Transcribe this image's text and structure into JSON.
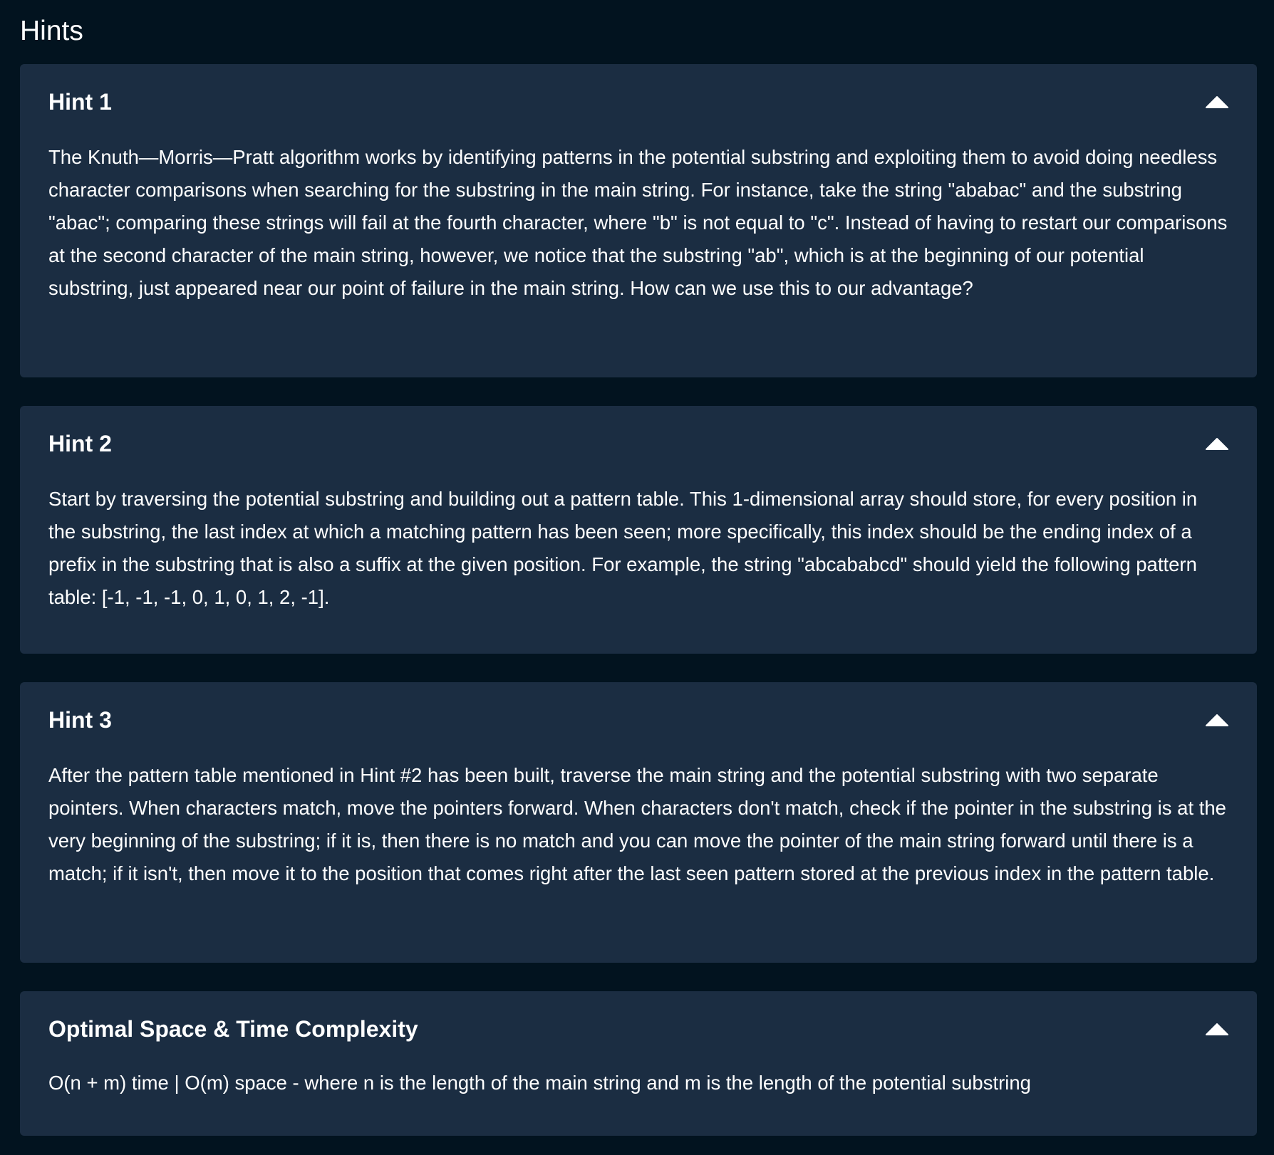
{
  "page": {
    "title": "Hints"
  },
  "panels": [
    {
      "title": "Hint 1",
      "icon": "chevron-up-icon",
      "expanded": true,
      "body": "The Knuth—Morris—Pratt algorithm works by identifying patterns in the potential substring and exploiting them to avoid doing needless character comparisons when searching for the substring in the main string. For instance, take the string \"ababac\" and the substring \"abac\"; comparing these strings will fail at the fourth character, where \"b\" is not equal to \"c\". Instead of having to restart our comparisons at the second character of the main string, however, we notice that the substring \"ab\", which is at the beginning of our potential substring, just appeared near our point of failure in the main string. How can we use this to our advantage?"
    },
    {
      "title": "Hint 2",
      "icon": "chevron-up-icon",
      "expanded": true,
      "body": "Start by traversing the potential substring and building out a pattern table. This 1-dimensional array should store, for every position in the substring, the last index at which a matching pattern has been seen; more specifically, this index should be the ending index of a prefix in the substring that is also a suffix at the given position. For example, the string \"abcababcd\" should yield the following pattern table: [-1, -1, -1, 0, 1, 0, 1, 2, -1]."
    },
    {
      "title": "Hint 3",
      "icon": "chevron-up-icon",
      "expanded": true,
      "body": "After the pattern table mentioned in Hint #2 has been built, traverse the main string and the potential substring with two separate pointers. When characters match, move the pointers forward. When characters don't match, check if the pointer in the substring is at the very beginning of the substring; if it is, then there is no match and you can move the pointer of the main string forward until there is a match; if it isn't, then move it to the position that comes right after the last seen pattern stored at the previous index in the pattern table."
    },
    {
      "title": "Optimal Space & Time Complexity",
      "icon": "chevron-up-icon",
      "expanded": true,
      "body": "O(n + m) time | O(m) space - where n is the length of the main string and m is the length of the potential substring"
    }
  ],
  "colors": {
    "background": "#02131f",
    "panel": "#1b2d42",
    "text": "#ffffff"
  }
}
